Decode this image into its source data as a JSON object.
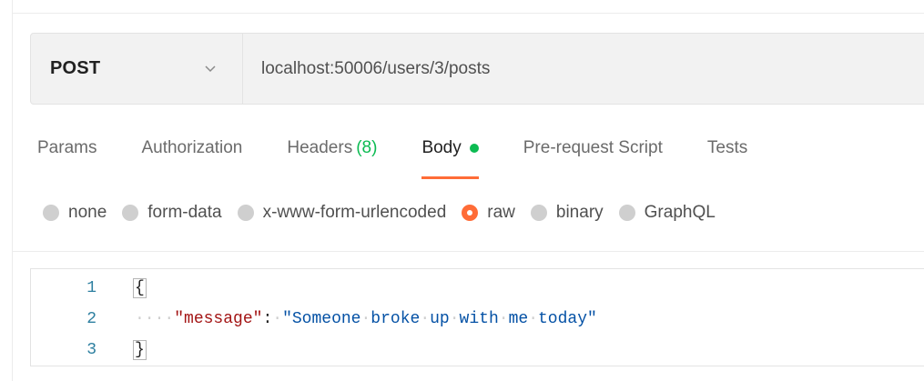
{
  "request": {
    "method": "POST",
    "url": "localhost:50006/users/3/posts"
  },
  "tabs": [
    {
      "label": "Params"
    },
    {
      "label": "Authorization"
    },
    {
      "label": "Headers",
      "count": "(8)"
    },
    {
      "label": "Body",
      "active": true
    },
    {
      "label": "Pre-request Script"
    },
    {
      "label": "Tests"
    }
  ],
  "body_types": [
    {
      "label": "none"
    },
    {
      "label": "form-data"
    },
    {
      "label": "x-www-form-urlencoded"
    },
    {
      "label": "raw",
      "selected": true
    },
    {
      "label": "binary"
    },
    {
      "label": "GraphQL"
    }
  ],
  "editor": {
    "lines": [
      {
        "number": "1",
        "text": "{"
      },
      {
        "number": "2",
        "key": "\"message\"",
        "colon": ":",
        "value": "\"Someone broke up with me today\""
      },
      {
        "number": "3",
        "text": "}"
      }
    ]
  },
  "colors": {
    "accent": "#ff6c37",
    "indicator": "#0cbb52",
    "json_key": "#a31515",
    "json_string": "#0451a5",
    "line_number": "#2d7fa0"
  },
  "icons": {
    "method_dropdown": "chevron-down-icon",
    "body_indicator": "dot-icon"
  }
}
